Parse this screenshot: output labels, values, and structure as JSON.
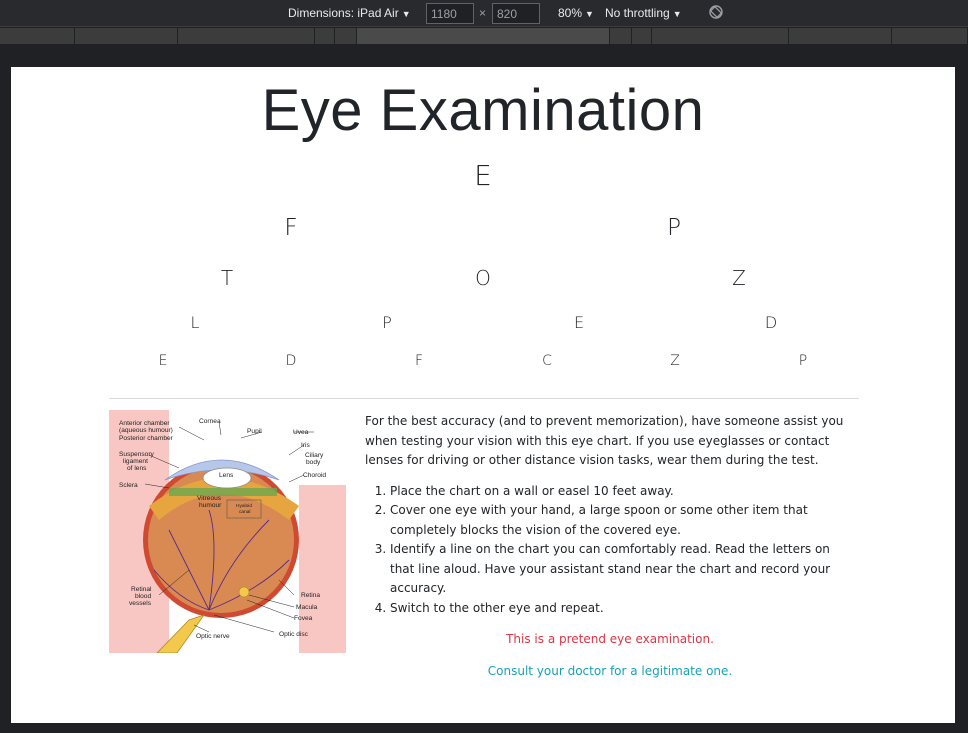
{
  "devtools": {
    "dimensions_label": "Dimensions: iPad Air",
    "width_value": "1180",
    "times": "×",
    "height_value": "820",
    "zoom": "80%",
    "throttling": "No throttling"
  },
  "page": {
    "title": "Eye Examination",
    "chart_rows": [
      [
        "E"
      ],
      [
        "F",
        "P"
      ],
      [
        "T",
        "O",
        "Z"
      ],
      [
        "L",
        "P",
        "E",
        "D"
      ],
      [
        "E",
        "D",
        "F",
        "C",
        "Z",
        "P"
      ]
    ],
    "intro": "For the best accuracy (and to prevent memorization), have someone assist you when testing your vision with this eye chart. If you use eyeglasses or contact lenses for driving or other distance vision tasks, wear them during the test.",
    "steps": [
      "Place the chart on a wall or easel 10 feet away.",
      "Cover one eye with your hand, a large spoon or some other item that completely blocks the vision of the covered eye.",
      "Identify a line on the chart you can comfortably read. Read the letters on that line aloud. Have your assistant stand near the chart and record your accuracy.",
      "Switch to the other eye and repeat."
    ],
    "warning": "This is a pretend eye examination.",
    "consult": "Consult your doctor for a legitimate one.",
    "warning_color": "#dc3545",
    "consult_color": "#17a2b8"
  },
  "diagram_labels": {
    "anterior": "Anterior chamber",
    "aqueous": "(aqueous humour)",
    "posterior": "Posterior chamber",
    "suspensory1": "Suspensory",
    "suspensory2": "ligament",
    "suspensory3": "of lens",
    "sclera": "Sclera",
    "cornea": "Cornea",
    "pupil": "Pupil",
    "uvea": "Uvea",
    "iris": "Iris",
    "ciliary1": "Ciliary",
    "ciliary2": "body",
    "choroid": "Choroid",
    "lens": "Lens",
    "vitreous1": "Vitreous",
    "vitreous2": "humour",
    "hyaloid1": "Hyaloid",
    "hyaloid2": "canal",
    "retinal1": "Retinal",
    "retinal2": "blood",
    "retinal3": "vessels",
    "retina": "Retina",
    "macula": "Macula",
    "fovea": "Fovea",
    "optic_nerve": "Optic nerve",
    "optic_disc": "Optic disc"
  },
  "icons": {
    "dropdown": "caret-down-icon",
    "rotate": "rotate-icon"
  }
}
